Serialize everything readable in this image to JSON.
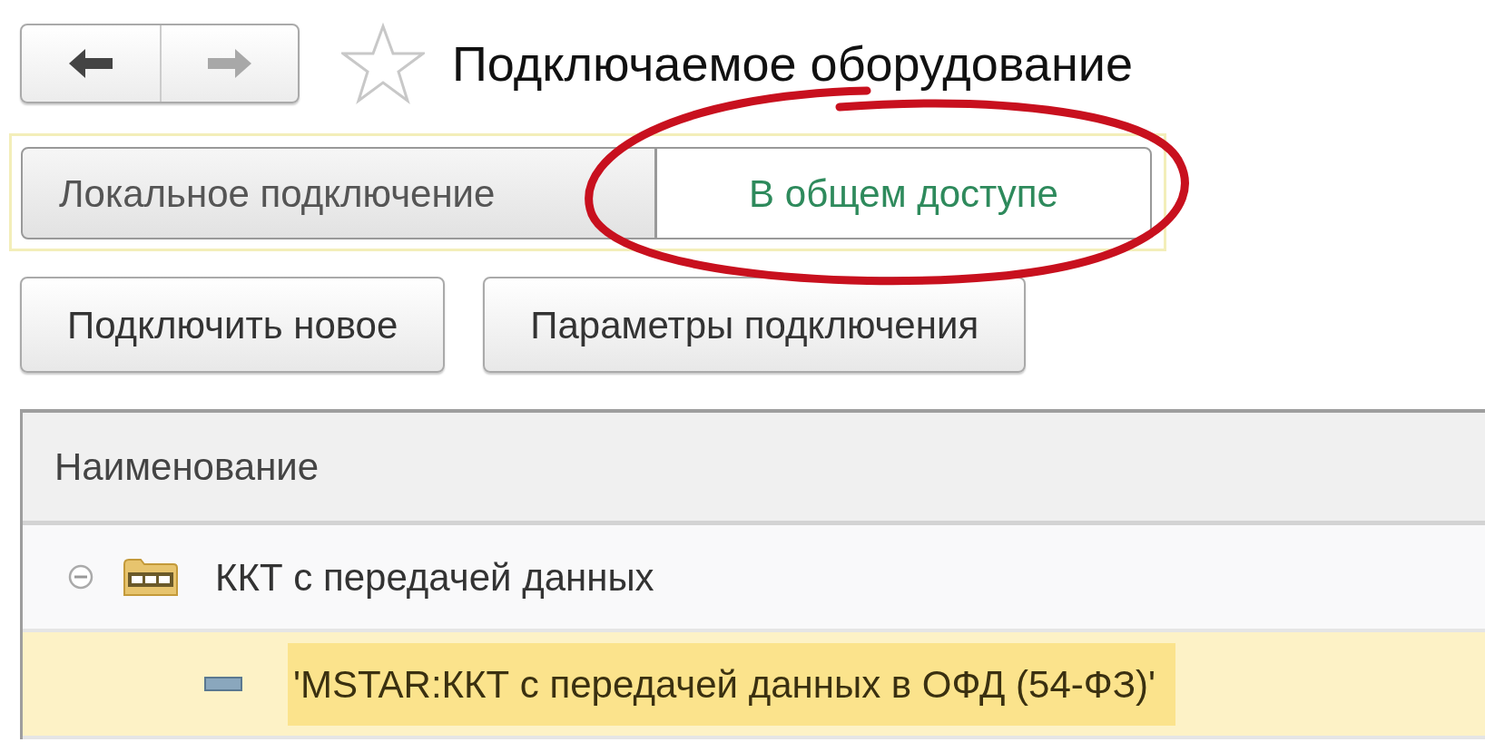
{
  "nav_buttons": [
    {
      "kind": "back",
      "disabled": false
    },
    {
      "kind": "forward",
      "disabled": true
    }
  ],
  "favorite": {
    "on": false
  },
  "title": "Подключаемое оборудование",
  "tabs": [
    {
      "label": "Локальное подключение",
      "selected": false
    },
    {
      "label": "В общем доступе",
      "selected": true
    }
  ],
  "buttons": [
    "Подключить новое",
    "Параметры подключения"
  ],
  "table": {
    "columns": [
      "Наименование"
    ],
    "rows": [
      {
        "kind": "group",
        "text": "ККТ с передачей данных",
        "expanded": true,
        "selected": false,
        "children": [
          {
            "kind": "item",
            "text": "'MSTAR:ККТ с передачей данных в ОФД (54-ФЗ)'",
            "selected": true
          }
        ]
      }
    ]
  },
  "annotation": {
    "kind": "ellipse"
  }
}
